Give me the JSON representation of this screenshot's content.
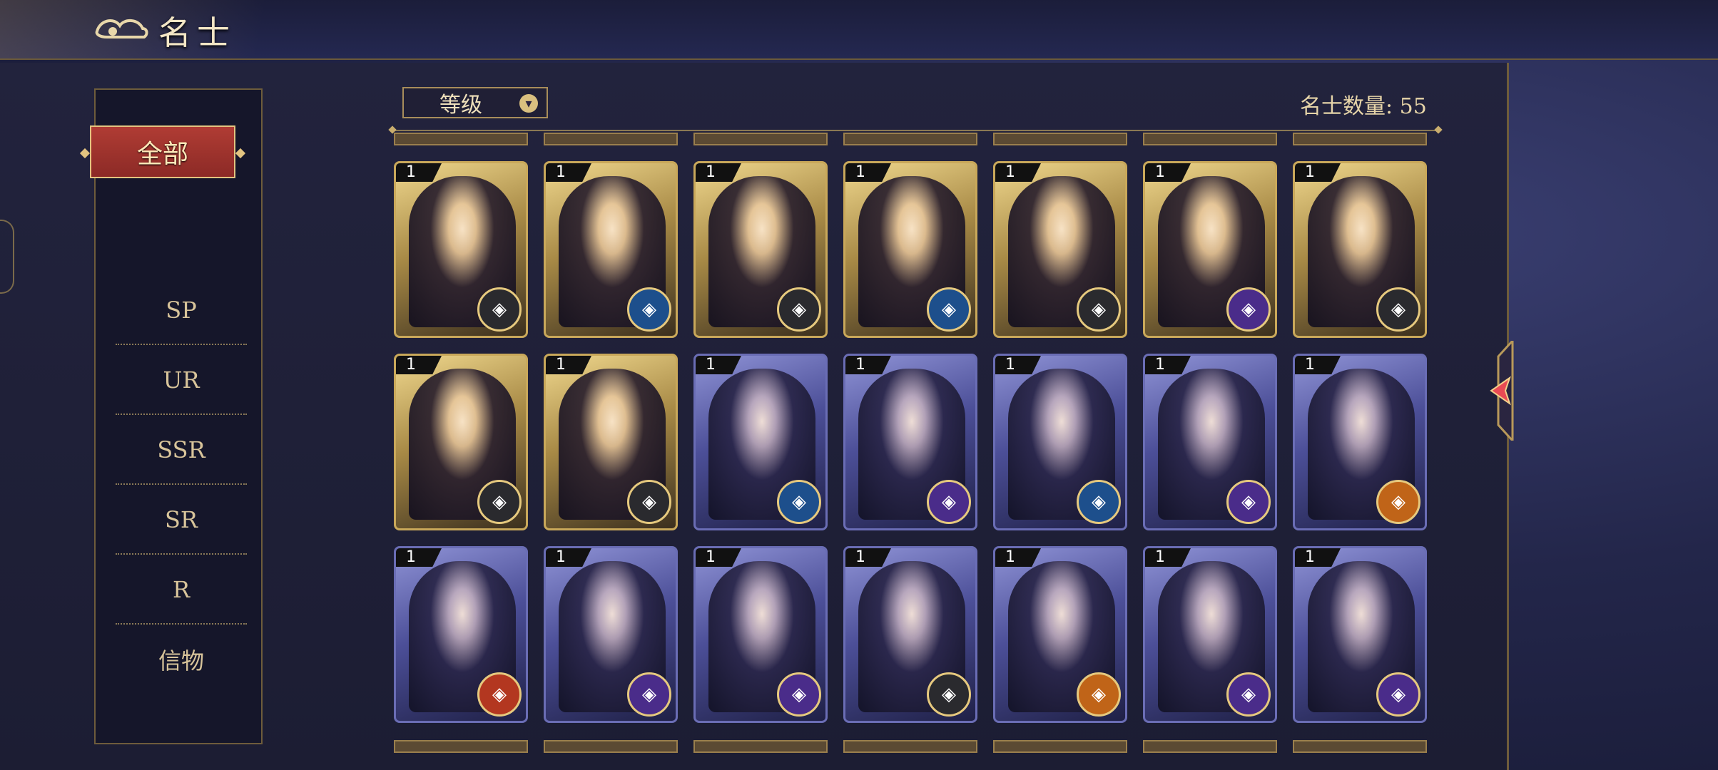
{
  "header": {
    "title": "名士"
  },
  "sidebar": {
    "items": [
      {
        "label": "全部",
        "active": true
      },
      {
        "label": "SP"
      },
      {
        "label": "UR"
      },
      {
        "label": "SSR"
      },
      {
        "label": "SR"
      },
      {
        "label": "R"
      },
      {
        "label": "信物"
      }
    ]
  },
  "toolbar": {
    "sort_label": "等级",
    "count_text": "名士数量: 55"
  },
  "colors": {
    "accent_red": "#b03c34",
    "gold": "#c9a85a"
  },
  "cards": [
    {
      "level": "1",
      "element_icon": "gray-element-icon",
      "frame": "gold"
    },
    {
      "level": "1",
      "element_icon": "blue-element-icon",
      "frame": "gold"
    },
    {
      "level": "1",
      "element_icon": "gray-element-icon",
      "frame": "gold"
    },
    {
      "level": "1",
      "element_icon": "blue-element-icon",
      "frame": "gold"
    },
    {
      "level": "1",
      "element_icon": "gray-element-icon",
      "frame": "gold"
    },
    {
      "level": "1",
      "element_icon": "purple-element-icon",
      "frame": "gold"
    },
    {
      "level": "1",
      "element_icon": "gray-element-icon",
      "frame": "gold"
    },
    {
      "level": "1",
      "element_icon": "gray-element-icon",
      "frame": "gold"
    },
    {
      "level": "1",
      "element_icon": "gray-element-icon",
      "frame": "gold"
    },
    {
      "level": "1",
      "element_icon": "blue-element-icon",
      "frame": "purple"
    },
    {
      "level": "1",
      "element_icon": "purple-element-icon",
      "frame": "purple"
    },
    {
      "level": "1",
      "element_icon": "blue-element-icon",
      "frame": "purple"
    },
    {
      "level": "1",
      "element_icon": "purple-element-icon",
      "frame": "purple"
    },
    {
      "level": "1",
      "element_icon": "orange-element-icon",
      "frame": "purple"
    },
    {
      "level": "1",
      "element_icon": "red-element-icon",
      "frame": "purple"
    },
    {
      "level": "1",
      "element_icon": "purple-element-icon",
      "frame": "purple"
    },
    {
      "level": "1",
      "element_icon": "purple-element-icon",
      "frame": "purple"
    },
    {
      "level": "1",
      "element_icon": "gray-element-icon",
      "frame": "purple"
    },
    {
      "level": "1",
      "element_icon": "orange-element-icon",
      "frame": "purple"
    },
    {
      "level": "1",
      "element_icon": "purple-element-icon",
      "frame": "purple"
    },
    {
      "level": "1",
      "element_icon": "purple-element-icon",
      "frame": "purple"
    }
  ]
}
